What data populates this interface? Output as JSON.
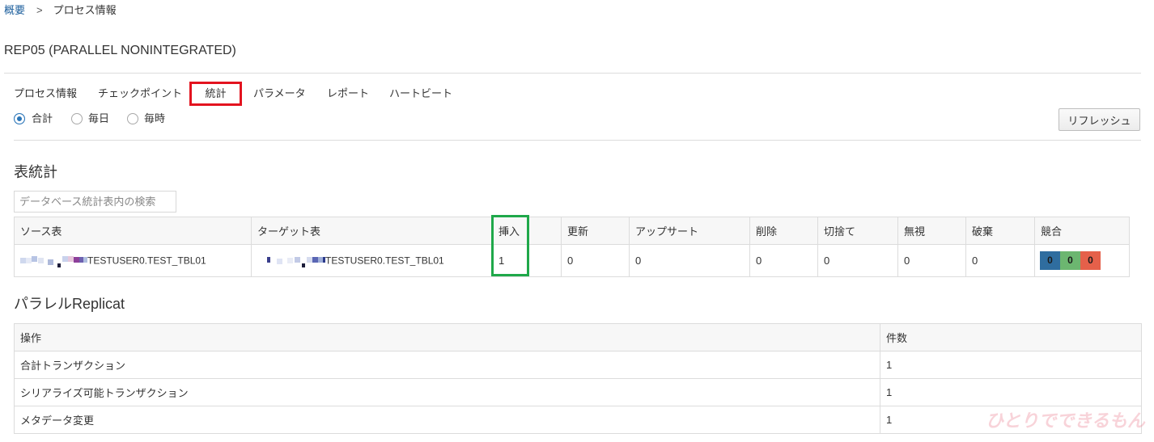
{
  "breadcrumb": {
    "home": "概要",
    "separator": ">",
    "current": "プロセス情報"
  },
  "page_title": "REP05 (PARALLEL NONINTEGRATED)",
  "tabs": [
    {
      "label": "プロセス情報",
      "active": false
    },
    {
      "label": "チェックポイント",
      "active": false
    },
    {
      "label": "統計",
      "active": true
    },
    {
      "label": "パラメータ",
      "active": false
    },
    {
      "label": "レポート",
      "active": false
    },
    {
      "label": "ハートビート",
      "active": false
    }
  ],
  "period": {
    "options": [
      {
        "label": "合計",
        "selected": true
      },
      {
        "label": "毎日",
        "selected": false
      },
      {
        "label": "毎時",
        "selected": false
      }
    ]
  },
  "refresh_button": "リフレッシュ",
  "table_stats": {
    "heading": "表統計",
    "search_placeholder": "データベース統計表内の検索",
    "columns": {
      "source": "ソース表",
      "target": "ターゲット表",
      "insert": "挿入",
      "update": "更新",
      "upsert": "アップサート",
      "delete": "削除",
      "truncate": "切捨て",
      "ignore": "無視",
      "discard": "破棄",
      "conflict": "競合"
    },
    "rows": [
      {
        "source": "TESTUSER0.TEST_TBL01",
        "target": "TESTUSER0.TEST_TBL01",
        "insert": "1",
        "update": "0",
        "upsert": "0",
        "delete": "0",
        "truncate": "0",
        "ignore": "0",
        "discard": "0",
        "conflicts": [
          "0",
          "0",
          "0"
        ]
      }
    ]
  },
  "parallel_replicat": {
    "heading": "パラレルReplicat",
    "columns": {
      "operation": "操作",
      "count": "件数"
    },
    "rows": [
      {
        "operation": "合計トランザクション",
        "count": "1"
      },
      {
        "operation": "シリアライズ可能トランザクション",
        "count": "1"
      },
      {
        "operation": "メタデータ変更",
        "count": "1"
      }
    ]
  },
  "colors": {
    "link": "#1b5e9c",
    "accent": "#2a75b8",
    "highlight_tab": "#e3131f",
    "highlight_column": "#1fa84a",
    "conflict_badges": [
      "#2f6d9f",
      "#6cb670",
      "#e5604a"
    ]
  },
  "watermark": "ひとりでできるもん"
}
